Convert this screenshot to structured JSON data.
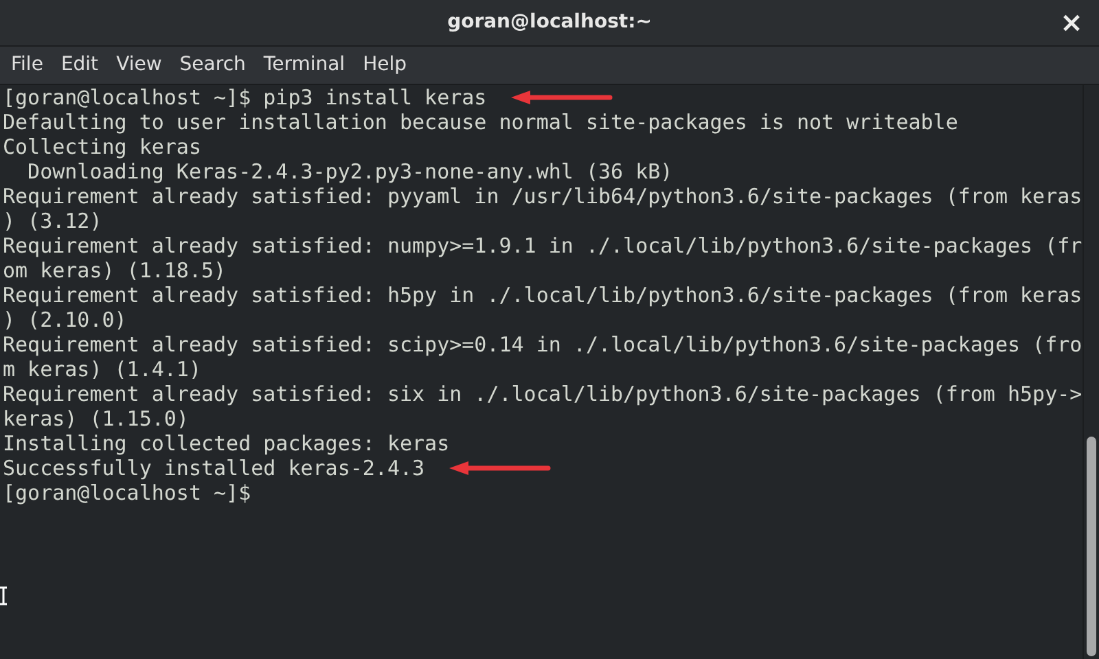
{
  "window": {
    "title": "goran@localhost:~",
    "close": "×"
  },
  "menu": [
    "File",
    "Edit",
    "View",
    "Search",
    "Terminal",
    "Help"
  ],
  "terminal": {
    "lines": [
      {
        "text": "[goran@localhost ~]$ pip3 install keras",
        "arrow": true
      },
      {
        "text": "Defaulting to user installation because normal site-packages is not writeable",
        "arrow": false
      },
      {
        "text": "Collecting keras",
        "arrow": false
      },
      {
        "text": "  Downloading Keras-2.4.3-py2.py3-none-any.whl (36 kB)",
        "arrow": false
      },
      {
        "text": "Requirement already satisfied: pyyaml in /usr/lib64/python3.6/site-packages (from keras",
        "arrow": false
      },
      {
        "text": ") (3.12)",
        "arrow": false
      },
      {
        "text": "Requirement already satisfied: numpy>=1.9.1 in ./.local/lib/python3.6/site-packages (fr",
        "arrow": false
      },
      {
        "text": "om keras) (1.18.5)",
        "arrow": false
      },
      {
        "text": "Requirement already satisfied: h5py in ./.local/lib/python3.6/site-packages (from keras",
        "arrow": false
      },
      {
        "text": ") (2.10.0)",
        "arrow": false
      },
      {
        "text": "Requirement already satisfied: scipy>=0.14 in ./.local/lib/python3.6/site-packages (fro",
        "arrow": false
      },
      {
        "text": "m keras) (1.4.1)",
        "arrow": false
      },
      {
        "text": "Requirement already satisfied: six in ./.local/lib/python3.6/site-packages (from h5py->",
        "arrow": false
      },
      {
        "text": "keras) (1.15.0)",
        "arrow": false
      },
      {
        "text": "Installing collected packages: keras",
        "arrow": false
      },
      {
        "text": "Successfully installed keras-2.4.3",
        "arrow": true
      },
      {
        "text": "[goran@localhost ~]$",
        "arrow": false
      }
    ]
  }
}
